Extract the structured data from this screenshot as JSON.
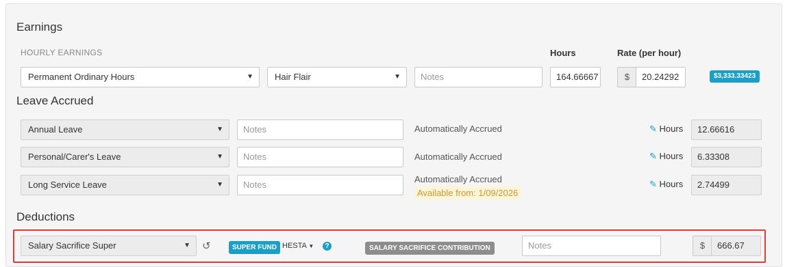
{
  "earnings": {
    "title": "Earnings",
    "hourly_label": "HOURLY EARNINGS",
    "hours_label": "Hours",
    "rate_label": "Rate (per hour)",
    "pay_category": "Permanent Ordinary Hours",
    "location": "Hair Flair",
    "notes_placeholder": "Notes",
    "hours_value": "164.66667",
    "currency_symbol": "$",
    "rate_value": "20.24292",
    "total_badge": "$3,333.33423"
  },
  "leave": {
    "title": "Leave Accrued",
    "rows": [
      {
        "category": "Annual Leave",
        "notes_placeholder": "Notes",
        "status": "Automatically Accrued",
        "hours_label": "Hours",
        "hours_value": "12.66616"
      },
      {
        "category": "Personal/Carer's Leave",
        "notes_placeholder": "Notes",
        "status": "Automatically Accrued",
        "hours_label": "Hours",
        "hours_value": "6.33308"
      },
      {
        "category": "Long Service Leave",
        "notes_placeholder": "Notes",
        "status": "Automatically Accrued",
        "available": "Available from: 1/09/2026",
        "hours_label": "Hours",
        "hours_value": "2.74499"
      }
    ]
  },
  "deductions": {
    "title": "Deductions",
    "category": "Salary Sacrifice Super",
    "super_fund_badge": "SUPER FUND",
    "fund_name": "HESTA",
    "contribution_badge": "SALARY SACRIFICE CONTRIBUTION",
    "notes_placeholder": "Notes",
    "currency_symbol": "$",
    "amount": "666.67"
  },
  "icons": {
    "caret": "▼",
    "pencil": "✎",
    "history": "↺",
    "help": "?"
  },
  "colors": {
    "accent": "#1b9fc6",
    "highlight": "#e03c3c",
    "available_bg": "#fcf4d6"
  }
}
